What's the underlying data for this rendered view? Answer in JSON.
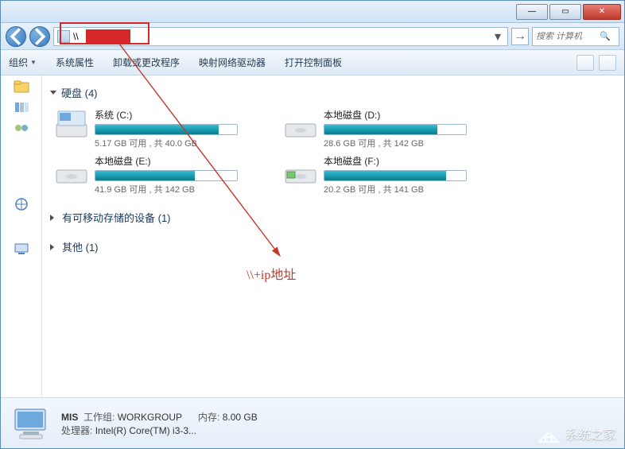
{
  "titlebar": {
    "min": "—",
    "max": "▭",
    "close": "✕"
  },
  "address": {
    "value": "\\\\",
    "go": "→"
  },
  "search": {
    "placeholder": "搜索 计算机"
  },
  "toolbar": {
    "organize": "组织",
    "sysprops": "系统属性",
    "uninstall": "卸载或更改程序",
    "mapdrive": "映射网络驱动器",
    "controlpanel": "打开控制面板"
  },
  "groups": {
    "disks_label": "硬盘 (4)",
    "removable_label": "有可移动存储的设备 (1)",
    "other_label": "其他 (1)"
  },
  "drives": [
    {
      "name": "系统 (C:)",
      "free": "5.17 GB 可用 , 共 40.0 GB",
      "used_pct": 87
    },
    {
      "name": "本地磁盘 (D:)",
      "free": "28.6 GB 可用 , 共 142 GB",
      "used_pct": 80
    },
    {
      "name": "本地磁盘 (E:)",
      "free": "41.9 GB 可用 , 共 142 GB",
      "used_pct": 70
    },
    {
      "name": "本地磁盘 (F:)",
      "free": "20.2 GB 可用 , 共 141 GB",
      "used_pct": 86
    }
  ],
  "details": {
    "name": "MIS",
    "workgroup_label": "工作组:",
    "workgroup": "WORKGROUP",
    "mem_label": "内存:",
    "mem": "8.00 GB",
    "cpu_label": "处理器:",
    "cpu": "Intel(R) Core(TM) i3-3..."
  },
  "annotation": {
    "label": "\\\\+ip地址"
  },
  "watermark": {
    "text": "系统之家"
  }
}
